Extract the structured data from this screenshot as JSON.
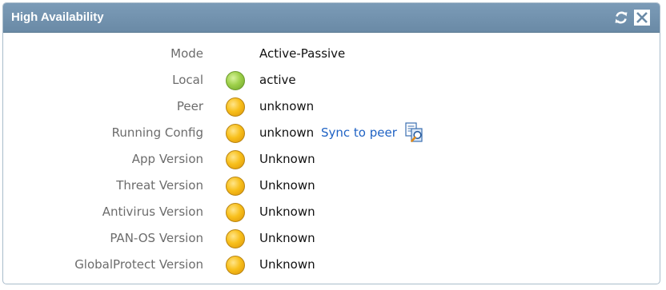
{
  "panel": {
    "title": "High Availability"
  },
  "toolbar": {
    "refresh_icon": "refresh-icon",
    "close_icon": "close-icon"
  },
  "rows": [
    {
      "label": "Mode",
      "status": null,
      "value": "Active-Passive"
    },
    {
      "label": "Local",
      "status": "green",
      "value": "active"
    },
    {
      "label": "Peer",
      "status": "yellow",
      "value": "unknown"
    },
    {
      "label": "Running Config",
      "status": "yellow",
      "value": "unknown",
      "link": "Sync to peer"
    },
    {
      "label": "App Version",
      "status": "yellow",
      "value": "Unknown"
    },
    {
      "label": "Threat Version",
      "status": "yellow",
      "value": "Unknown"
    },
    {
      "label": "Antivirus Version",
      "status": "yellow",
      "value": "Unknown"
    },
    {
      "label": "PAN-OS Version",
      "status": "yellow",
      "value": "Unknown"
    },
    {
      "label": "GlobalProtect Version",
      "status": "yellow",
      "value": "Unknown"
    }
  ],
  "colors": {
    "titlebar": "#7292ae",
    "status_green": "#9ed04a",
    "status_yellow": "#f8c01c",
    "link": "#1f62c4"
  }
}
